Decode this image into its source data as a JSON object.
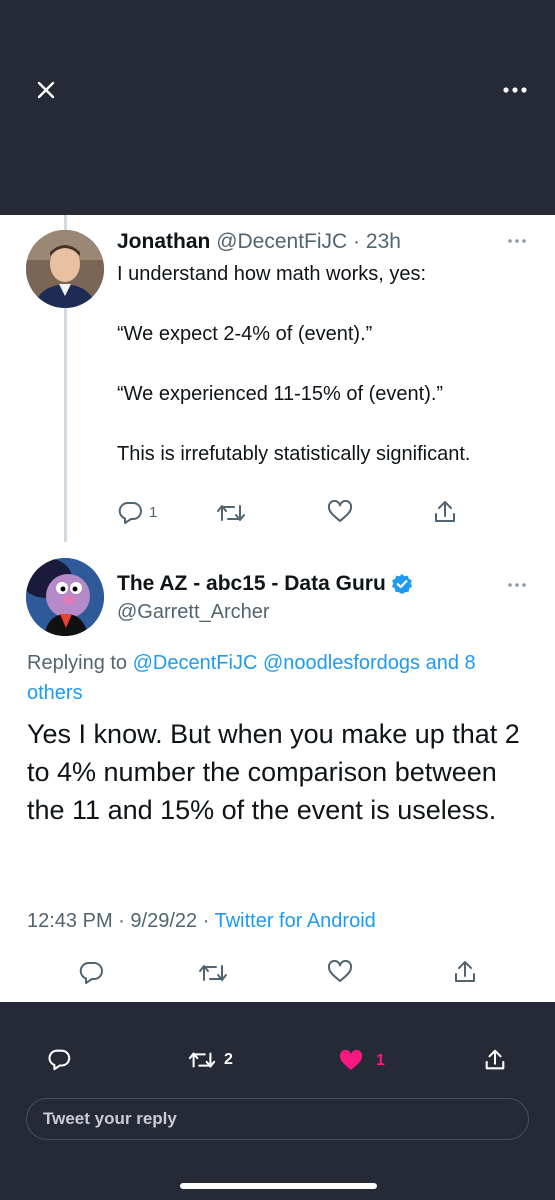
{
  "topbar": {
    "close_icon": "close-icon",
    "more_icon": "more-icon"
  },
  "tweet1": {
    "name": "Jonathan",
    "handle": "@DecentFiJC",
    "separator": "·",
    "time": "23h",
    "body": "I understand how math works, yes:\n\n“We expect 2-4% of (event).”\n\n“We experienced 11-15% of (event).”\n\nThis is irrefutably statistically significant.",
    "reply_count": "1"
  },
  "tweet2": {
    "name": "The AZ - abc15 - Data Guru",
    "handle": "@Garrett_Archer",
    "replying_prefix": "Replying to",
    "replying_users": "@DecentFiJC @noodlesfordogs and 8 others",
    "body": "Yes I know. But when you make up that 2 to 4% number the comparison between the 11 and 15% of the event is useless.",
    "time": "12:43 PM",
    "date": "9/29/22",
    "dot": "·",
    "source": "Twitter for Android"
  },
  "bottom_bar": {
    "retweet_count": "2",
    "like_count": "1",
    "reply_placeholder": "Tweet your reply"
  },
  "colors": {
    "background_dark": "#262936",
    "link": "#1d9bf0",
    "like": "#f91880",
    "muted": "#536471"
  }
}
